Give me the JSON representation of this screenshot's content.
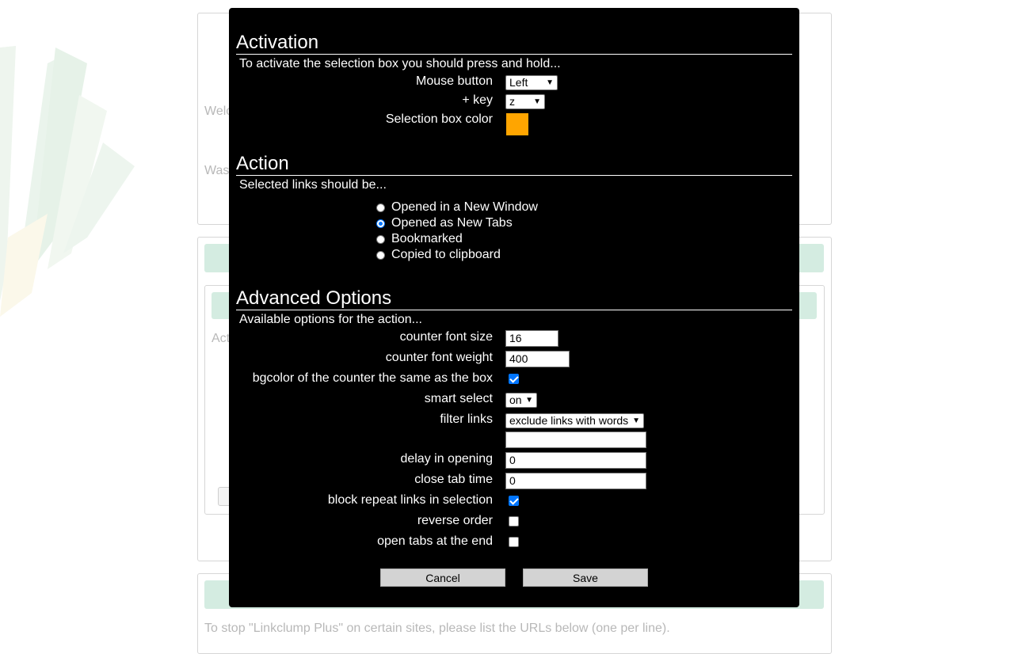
{
  "background": {
    "welcome_text": "Welc",
    "was_text": "Was",
    "active_text": "Acti",
    "footer_text": "To stop \"Linkclump Plus\" on certain sites, please list the URLs below (one per line)."
  },
  "activation": {
    "title": "Activation",
    "description": "To activate the selection box you should press and hold...",
    "mouse_button_label": "Mouse button",
    "mouse_button_value": "Left",
    "key_label": "+ key",
    "key_value": "z",
    "color_label": "Selection box color",
    "color_value": "#FFA500"
  },
  "action": {
    "title": "Action",
    "description": "Selected links should be...",
    "options": [
      {
        "label": "Opened in a New Window",
        "selected": false
      },
      {
        "label": "Opened as New Tabs",
        "selected": true
      },
      {
        "label": "Bookmarked",
        "selected": false
      },
      {
        "label": "Copied to clipboard",
        "selected": false
      }
    ]
  },
  "advanced": {
    "title": "Advanced Options",
    "description": "Available options for the action...",
    "counter_font_size_label": "counter font size",
    "counter_font_size_value": "16",
    "counter_font_weight_label": "counter font weight",
    "counter_font_weight_value": "400",
    "bgcolor_label": "bgcolor of the counter the same as the box",
    "bgcolor_checked": true,
    "smart_select_label": "smart select",
    "smart_select_value": "on",
    "filter_links_label": "filter links",
    "filter_links_value": "exclude links with words",
    "filter_words_value": "",
    "delay_label": "delay in opening",
    "delay_value": "0",
    "close_tab_label": "close tab time",
    "close_tab_value": "0",
    "block_repeat_label": "block repeat links in selection",
    "block_repeat_checked": true,
    "reverse_order_label": "reverse order",
    "reverse_order_checked": false,
    "open_end_label": "open tabs at the end",
    "open_end_checked": false
  },
  "buttons": {
    "cancel_label": "Cancel",
    "save_label": "Save"
  },
  "colors": {
    "modal_bg": "#000000",
    "swatch": "#FFA500",
    "accent": "#0075FF",
    "band": "#D4ECE1"
  }
}
